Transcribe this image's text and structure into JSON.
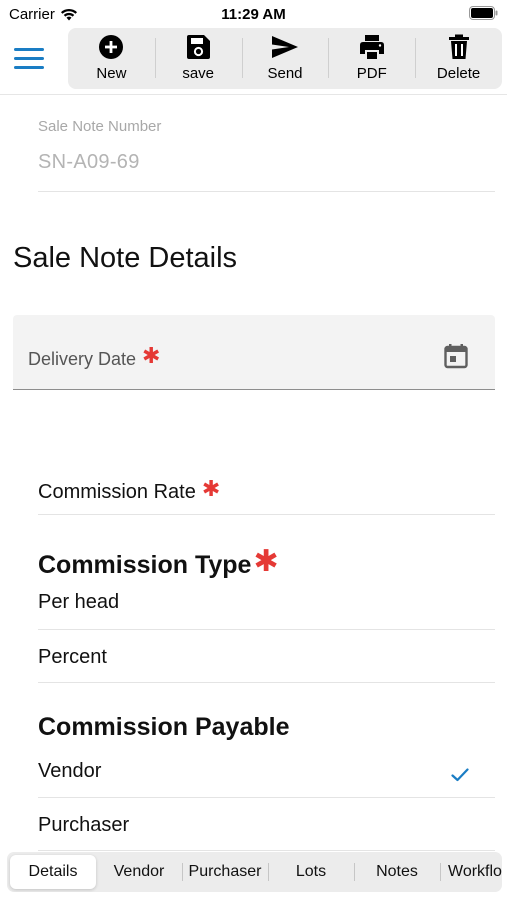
{
  "status": {
    "carrier": "Carrier",
    "time": "11:29 AM"
  },
  "toolbar": {
    "items": [
      {
        "label": "New",
        "icon": "add-circle-icon"
      },
      {
        "label": "save",
        "icon": "floppy-disk-icon"
      },
      {
        "label": "Send",
        "icon": "send-icon"
      },
      {
        "label": "PDF",
        "icon": "printer-icon"
      },
      {
        "label": "Delete",
        "icon": "trash-icon"
      }
    ]
  },
  "sale_note_number": {
    "label": "Sale Note Number",
    "value": "SN-A09-69"
  },
  "details_section": {
    "title": "Sale Note Details"
  },
  "delivery_date": {
    "label": "Delivery Date",
    "required_mark": "✱"
  },
  "commission_rate": {
    "label": "Commission Rate",
    "required_mark": "✱"
  },
  "commission_type": {
    "title": "Commission Type",
    "required_mark": "✱",
    "options": [
      "Per head",
      "Percent"
    ]
  },
  "commission_payable": {
    "title": "Commission Payable",
    "options": [
      "Vendor",
      "Purchaser"
    ],
    "selected": "Vendor"
  },
  "bottom_tabs": {
    "items": [
      "Details",
      "Vendor",
      "Purchaser",
      "Lots",
      "Notes",
      "Workflow"
    ],
    "active": "Details"
  },
  "colors": {
    "accent": "#1a7dc4",
    "required": "#e53935"
  }
}
